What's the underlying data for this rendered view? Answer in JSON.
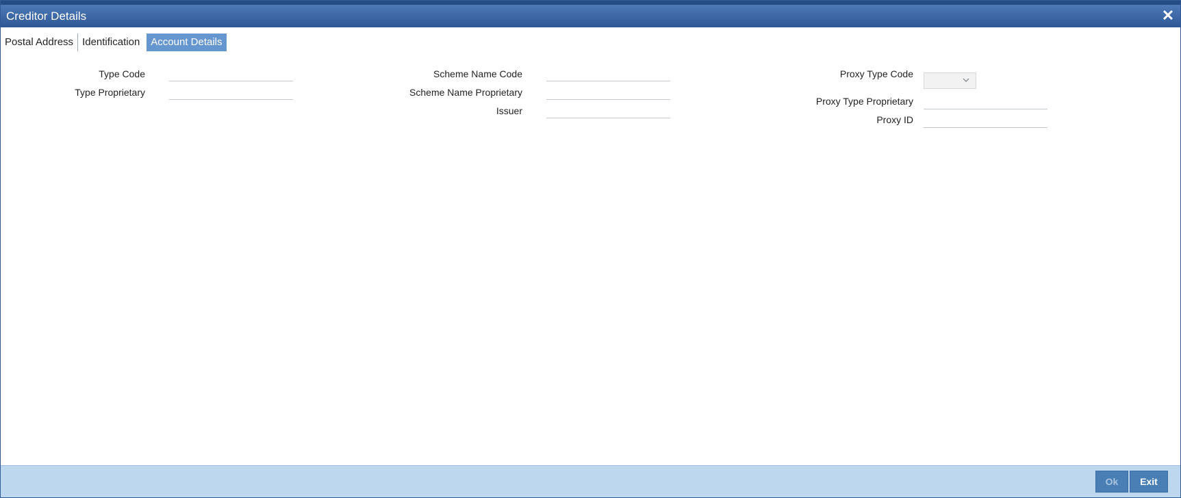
{
  "window": {
    "title": "Creditor Details",
    "close_glyph": "✕"
  },
  "tabs": [
    {
      "label": "Postal Address",
      "active": false
    },
    {
      "label": "Identification",
      "active": false
    },
    {
      "label": "Account Details",
      "active": true
    }
  ],
  "column1": {
    "type_code_label": "Type Code",
    "type_code_value": "",
    "type_proprietary_label": "Type Proprietary",
    "type_proprietary_value": ""
  },
  "column2": {
    "scheme_name_code_label": "Scheme Name Code",
    "scheme_name_code_value": "",
    "scheme_name_proprietary_label": "Scheme Name Proprietary",
    "scheme_name_proprietary_value": "",
    "issuer_label": "Issuer",
    "issuer_value": ""
  },
  "column3": {
    "proxy_type_code_label": "Proxy Type Code",
    "proxy_type_code_value": "",
    "proxy_type_proprietary_label": "Proxy Type Proprietary",
    "proxy_type_proprietary_value": "",
    "proxy_id_label": "Proxy ID",
    "proxy_id_value": ""
  },
  "footer": {
    "ok_label": "Ok",
    "exit_label": "Exit"
  },
  "colors": {
    "title_bar": "#2e5795",
    "active_tab": "#6596d0",
    "footer_bg": "#bdd7ee",
    "button": "#4a7fb6"
  },
  "icons": {
    "close": "close-icon",
    "dropdown": "chevron-down-icon"
  }
}
